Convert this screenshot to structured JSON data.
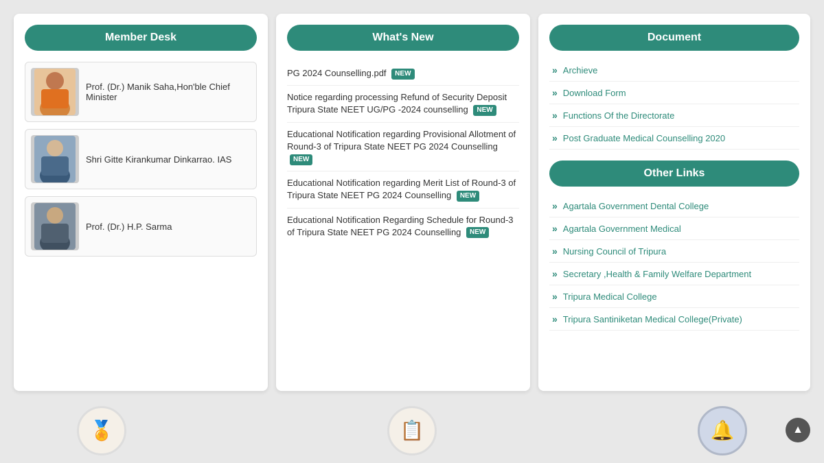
{
  "left_panel": {
    "header": "Member Desk",
    "members": [
      {
        "name": "Prof. (Dr.) Manik Saha,Hon'ble Chief Minister",
        "avatar_color1": "#e8c49a",
        "avatar_color2": "#c9956a"
      },
      {
        "name": "Shri Gitte Kirankumar Dinkarrao. IAS",
        "avatar_color1": "#8fa8c0",
        "avatar_color2": "#5a7a9a"
      },
      {
        "name": "Prof. (Dr.) H.P. Sarma",
        "avatar_color1": "#8090a0",
        "avatar_color2": "#607080"
      }
    ]
  },
  "middle_panel": {
    "header": "What's New",
    "news": [
      {
        "text": "PG 2024 Counselling.pdf",
        "is_new": true
      },
      {
        "text": "Notice regarding processing Refund of Security Deposit Tripura State NEET UG/PG -2024 counselling",
        "is_new": true
      },
      {
        "text": "Educational Notification regarding Provisional Allotment of Round-3 of Tripura State NEET PG 2024 Counselling",
        "is_new": true
      },
      {
        "text": "Educational Notification regarding Merit List of Round-3 of Tripura State NEET PG 2024 Counselling",
        "is_new": true
      },
      {
        "text": "Educational Notification Regarding Schedule for Round-3 of Tripura State NEET PG 2024 Counselling",
        "is_new": true
      }
    ]
  },
  "right_panel": {
    "doc_header": "Document",
    "documents": [
      {
        "label": "Archieve"
      },
      {
        "label": "Download Form"
      },
      {
        "label": "Functions Of the Directorate"
      },
      {
        "label": "Post Graduate Medical Counselling 2020"
      }
    ],
    "links_header": "Other Links",
    "links": [
      {
        "label": "Agartala Government Dental College"
      },
      {
        "label": "Agartala Government Medical"
      },
      {
        "label": "Nursing Council of Tripura"
      },
      {
        "label": "Secretary ,Health & Family Welfare Department"
      },
      {
        "label": "Tripura Medical College"
      },
      {
        "label": "Tripura Santiniketan Medical College(Private)"
      }
    ]
  },
  "bottom_icons": [
    {
      "icon": "🏅",
      "name": "award"
    },
    {
      "icon": "📋",
      "name": "checklist"
    },
    {
      "icon": "🔔",
      "name": "bell"
    }
  ],
  "scroll_btn": "▲",
  "new_badge_text": "NEW"
}
